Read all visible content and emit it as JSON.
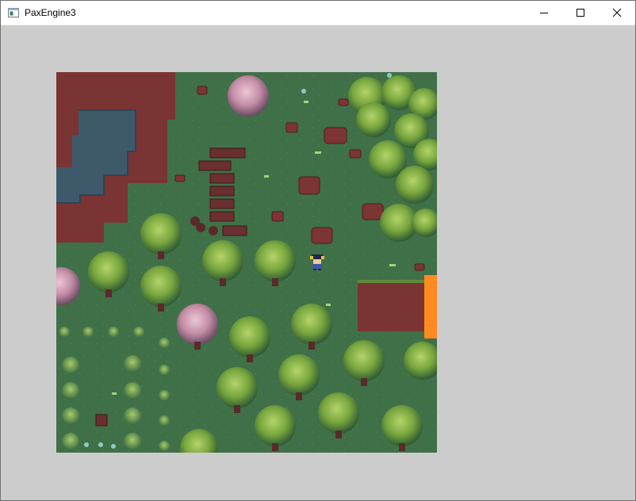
{
  "window": {
    "title": "PaxEngine3",
    "icons": {
      "app": "app-window-icon",
      "minimize": "minimize-icon",
      "maximize": "maximize-icon",
      "close": "close-icon"
    }
  },
  "scene": {
    "description_tags": [
      "tilemap",
      "forest",
      "pond",
      "dirt-clearing",
      "player-character",
      "trigger-zone"
    ],
    "colors": {
      "grass": "#3f7048",
      "dirt": "#7a3434",
      "water": "#3e5a6a",
      "tree_green": "#6e9a3a",
      "tree_pink": "#c48ea6",
      "stump": "#7d3434",
      "trigger_zone": "#ff8a1f",
      "background": "#cccccc"
    }
  }
}
